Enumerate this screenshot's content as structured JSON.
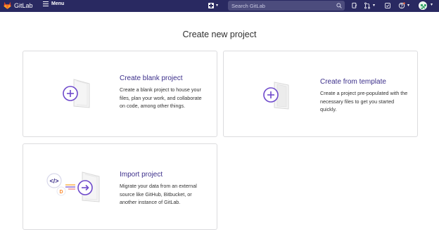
{
  "navbar": {
    "brand": "GitLab",
    "menu_label": "Menu",
    "search_placeholder": "Search GitLab",
    "icons": [
      "gitlab-logo",
      "menu-icon",
      "plus-square-icon",
      "search-icon",
      "merge-requests-icon",
      "issues-icon",
      "todo-icon",
      "help-icon",
      "avatar"
    ]
  },
  "page": {
    "title": "Create new project"
  },
  "cards": [
    {
      "heading": "Create blank project",
      "description": "Create a blank project to house your files, plan your work, and collaborate on code, among other things."
    },
    {
      "heading": "Create from template",
      "description": "Create a project pre-populated with the necessary files to get you started quickly."
    },
    {
      "heading": "Import project",
      "description": "Migrate your data from an external source like GitHub, Bitbucket, or another instance of GitLab."
    }
  ],
  "colors": {
    "navbar": "#292961",
    "accent": "#6e49cb",
    "heading": "#3b2e8a",
    "border": "#dcdcde"
  }
}
